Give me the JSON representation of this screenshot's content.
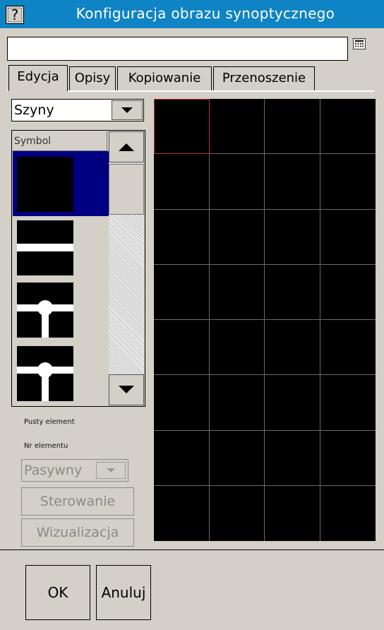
{
  "window": {
    "title": "Konfiguracja obrazu synoptycznego",
    "help_label": "?"
  },
  "toolbar": {
    "field_value": "",
    "icon": "calculator-icon"
  },
  "tabs": [
    {
      "label": "Edycja",
      "active": true
    },
    {
      "label": "Opisy",
      "active": false
    },
    {
      "label": "Kopiowanie",
      "active": false
    },
    {
      "label": "Przenoszenie",
      "active": false
    }
  ],
  "category_select": {
    "value": "Szyny"
  },
  "symbol_list": {
    "header": "Symbol",
    "items": [
      "empty-symbol",
      "horizontal-bus-symbol",
      "bus-tee-junction-symbol",
      "bus-tee-junction-symbol"
    ],
    "selected_index": 0
  },
  "element_info": {
    "name_label": "Pusty element",
    "number_label": "Nr elementu",
    "mode_value": "Pasywny",
    "control_button": "Sterowanie",
    "visualization_button": "Wizualizacja"
  },
  "synoptic_grid": {
    "columns": 4,
    "rows": 8,
    "selected_cell": [
      0,
      0
    ]
  },
  "footer": {
    "ok_label": "OK",
    "cancel_label": "Anuluj"
  },
  "colors": {
    "title_bar": "#0f84c4",
    "selection": "#000080",
    "grid_lines": "#6a6a6a",
    "selected_cell_border": "#c03030"
  }
}
